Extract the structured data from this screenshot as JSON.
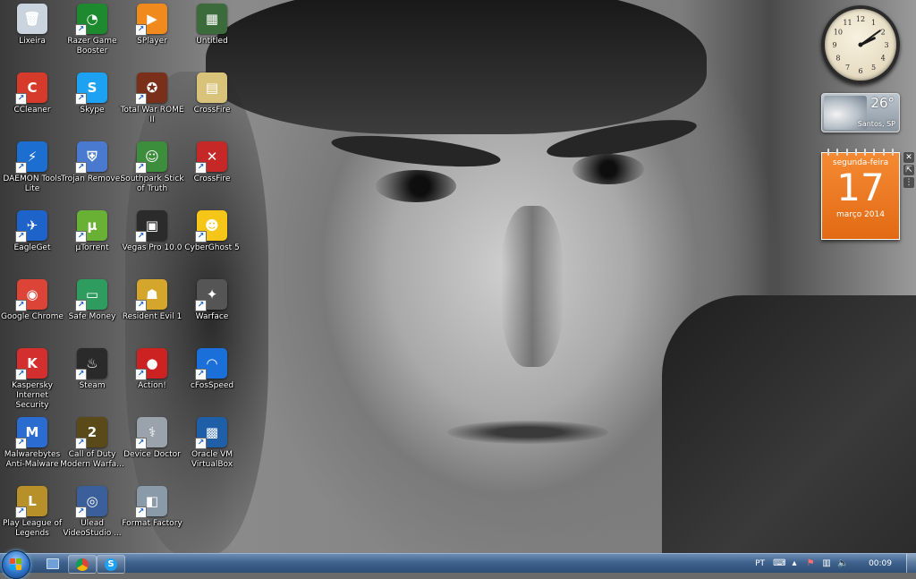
{
  "desktop": {
    "icons": [
      {
        "label": "Lixeira",
        "glyph": "🗑",
        "color": "#c9d4df",
        "shortcut": false
      },
      {
        "label": "Razer Game\nBooster",
        "glyph": "◔",
        "color": "#1d8a2f",
        "shortcut": true
      },
      {
        "label": "SPlayer",
        "glyph": "▶",
        "color": "#f08a1c",
        "shortcut": true
      },
      {
        "label": "Untitled",
        "glyph": "▦",
        "color": "#3b6b3a",
        "shortcut": false
      },
      {
        "label": "CCleaner",
        "glyph": "C",
        "color": "#d63a2a",
        "shortcut": true
      },
      {
        "label": "Skype",
        "glyph": "S",
        "color": "#1da1f2",
        "shortcut": true
      },
      {
        "label": "Total War ROME\nII",
        "glyph": "✪",
        "color": "#7a2f1a",
        "shortcut": true
      },
      {
        "label": "CrossFire",
        "glyph": "▤",
        "color": "#d9c27a",
        "shortcut": false
      },
      {
        "label": "DAEMON Tools\nLite",
        "glyph": "⚡",
        "color": "#1c6fd1",
        "shortcut": true
      },
      {
        "label": "Trojan Remover",
        "glyph": "⛨",
        "color": "#4a7ad0",
        "shortcut": true
      },
      {
        "label": "Southpark Stick\nof Truth",
        "glyph": "☺",
        "color": "#3c8d3c",
        "shortcut": true
      },
      {
        "label": "CrossFire",
        "glyph": "✕",
        "color": "#c62828",
        "shortcut": true
      },
      {
        "label": "EagleGet",
        "glyph": "✈",
        "color": "#1e63c9",
        "shortcut": true
      },
      {
        "label": "µTorrent",
        "glyph": "µ",
        "color": "#69b135",
        "shortcut": true
      },
      {
        "label": "Vegas Pro 10.0",
        "glyph": "▣",
        "color": "#2b2b2b",
        "shortcut": true
      },
      {
        "label": "CyberGhost 5",
        "glyph": "☻",
        "color": "#f5c518",
        "shortcut": true
      },
      {
        "label": "Google Chrome",
        "glyph": "◉",
        "color": "#db4437",
        "shortcut": true
      },
      {
        "label": "Safe Money",
        "glyph": "▭",
        "color": "#2e9b5f",
        "shortcut": true
      },
      {
        "label": "Resident Evil 1",
        "glyph": "☗",
        "color": "#d4a72c",
        "shortcut": true
      },
      {
        "label": "Warface",
        "glyph": "✦",
        "color": "#555555",
        "shortcut": true
      },
      {
        "label": "Kaspersky\nInternet Security",
        "glyph": "K",
        "color": "#d32f2f",
        "shortcut": true
      },
      {
        "label": "Steam",
        "glyph": "♨",
        "color": "#2a2a2a",
        "shortcut": true
      },
      {
        "label": "Action!",
        "glyph": "●",
        "color": "#cc2222",
        "shortcut": true
      },
      {
        "label": "cFosSpeed",
        "glyph": "◠",
        "color": "#1b6fd8",
        "shortcut": true
      },
      {
        "label": "Malwarebytes\nAnti-Malware",
        "glyph": "M",
        "color": "#2b6cd1",
        "shortcut": true
      },
      {
        "label": "Call of Duty\nModern Warfa...",
        "glyph": "2",
        "color": "#5a4a1a",
        "shortcut": true
      },
      {
        "label": "Device Doctor",
        "glyph": "⚕",
        "color": "#9aa3ab",
        "shortcut": true
      },
      {
        "label": "Oracle VM\nVirtualBox",
        "glyph": "▩",
        "color": "#1f5fa8",
        "shortcut": true
      },
      {
        "label": "Play League of\nLegends",
        "glyph": "L",
        "color": "#b8902a",
        "shortcut": true
      },
      {
        "label": "Ulead\nVideoStudio ...",
        "glyph": "◎",
        "color": "#3a5f9a",
        "shortcut": true
      },
      {
        "label": "Format Factory",
        "glyph": "◧",
        "color": "#8a9aa8",
        "shortcut": true
      }
    ]
  },
  "gadgets": {
    "clock": {
      "hour": 2,
      "minute": 9
    },
    "weather": {
      "temperature": "26°",
      "city": "Santos, SP"
    },
    "calendar": {
      "weekday": "segunda-feira",
      "day": "17",
      "month_year": "março 2014"
    },
    "controls": [
      "✕",
      "⇱",
      "⋮"
    ]
  },
  "taskbar": {
    "pinned": [
      {
        "name": "show-desktop-app",
        "color": "#6fa0d8"
      },
      {
        "name": "chrome",
        "color": "#db4437"
      },
      {
        "name": "skype",
        "color": "#1da1f2"
      }
    ],
    "tray": {
      "language": "PT",
      "time": "00:09"
    }
  },
  "colors": {
    "taskbar": "#3f638e",
    "calendar": "#f07b22",
    "label_text": "#ffffff"
  }
}
